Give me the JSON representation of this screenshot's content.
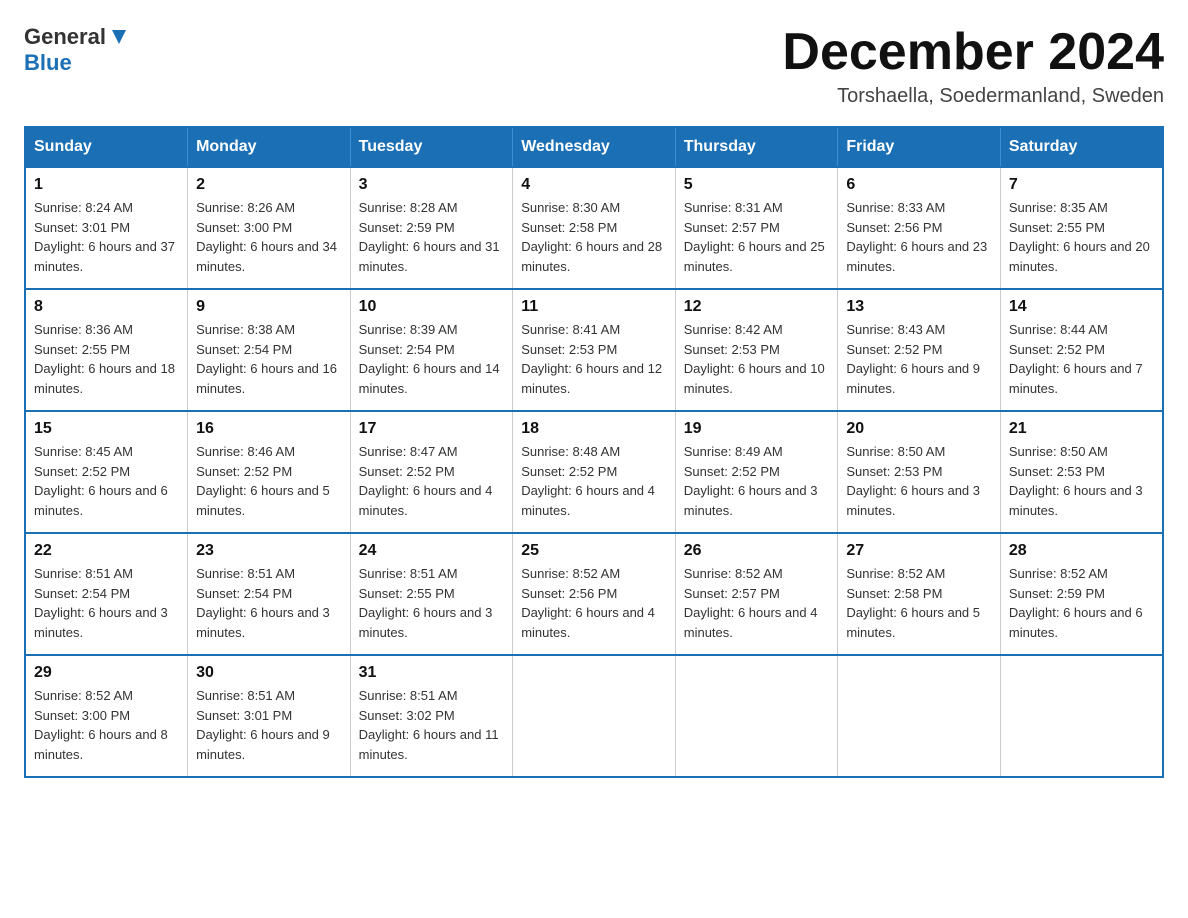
{
  "logo": {
    "general": "General",
    "blue": "Blue"
  },
  "header": {
    "month_year": "December 2024",
    "location": "Torshaella, Soedermanland, Sweden"
  },
  "weekdays": [
    "Sunday",
    "Monday",
    "Tuesday",
    "Wednesday",
    "Thursday",
    "Friday",
    "Saturday"
  ],
  "weeks": [
    [
      {
        "day": "1",
        "sunrise": "8:24 AM",
        "sunset": "3:01 PM",
        "daylight": "6 hours and 37 minutes."
      },
      {
        "day": "2",
        "sunrise": "8:26 AM",
        "sunset": "3:00 PM",
        "daylight": "6 hours and 34 minutes."
      },
      {
        "day": "3",
        "sunrise": "8:28 AM",
        "sunset": "2:59 PM",
        "daylight": "6 hours and 31 minutes."
      },
      {
        "day": "4",
        "sunrise": "8:30 AM",
        "sunset": "2:58 PM",
        "daylight": "6 hours and 28 minutes."
      },
      {
        "day": "5",
        "sunrise": "8:31 AM",
        "sunset": "2:57 PM",
        "daylight": "6 hours and 25 minutes."
      },
      {
        "day": "6",
        "sunrise": "8:33 AM",
        "sunset": "2:56 PM",
        "daylight": "6 hours and 23 minutes."
      },
      {
        "day": "7",
        "sunrise": "8:35 AM",
        "sunset": "2:55 PM",
        "daylight": "6 hours and 20 minutes."
      }
    ],
    [
      {
        "day": "8",
        "sunrise": "8:36 AM",
        "sunset": "2:55 PM",
        "daylight": "6 hours and 18 minutes."
      },
      {
        "day": "9",
        "sunrise": "8:38 AM",
        "sunset": "2:54 PM",
        "daylight": "6 hours and 16 minutes."
      },
      {
        "day": "10",
        "sunrise": "8:39 AM",
        "sunset": "2:54 PM",
        "daylight": "6 hours and 14 minutes."
      },
      {
        "day": "11",
        "sunrise": "8:41 AM",
        "sunset": "2:53 PM",
        "daylight": "6 hours and 12 minutes."
      },
      {
        "day": "12",
        "sunrise": "8:42 AM",
        "sunset": "2:53 PM",
        "daylight": "6 hours and 10 minutes."
      },
      {
        "day": "13",
        "sunrise": "8:43 AM",
        "sunset": "2:52 PM",
        "daylight": "6 hours and 9 minutes."
      },
      {
        "day": "14",
        "sunrise": "8:44 AM",
        "sunset": "2:52 PM",
        "daylight": "6 hours and 7 minutes."
      }
    ],
    [
      {
        "day": "15",
        "sunrise": "8:45 AM",
        "sunset": "2:52 PM",
        "daylight": "6 hours and 6 minutes."
      },
      {
        "day": "16",
        "sunrise": "8:46 AM",
        "sunset": "2:52 PM",
        "daylight": "6 hours and 5 minutes."
      },
      {
        "day": "17",
        "sunrise": "8:47 AM",
        "sunset": "2:52 PM",
        "daylight": "6 hours and 4 minutes."
      },
      {
        "day": "18",
        "sunrise": "8:48 AM",
        "sunset": "2:52 PM",
        "daylight": "6 hours and 4 minutes."
      },
      {
        "day": "19",
        "sunrise": "8:49 AM",
        "sunset": "2:52 PM",
        "daylight": "6 hours and 3 minutes."
      },
      {
        "day": "20",
        "sunrise": "8:50 AM",
        "sunset": "2:53 PM",
        "daylight": "6 hours and 3 minutes."
      },
      {
        "day": "21",
        "sunrise": "8:50 AM",
        "sunset": "2:53 PM",
        "daylight": "6 hours and 3 minutes."
      }
    ],
    [
      {
        "day": "22",
        "sunrise": "8:51 AM",
        "sunset": "2:54 PM",
        "daylight": "6 hours and 3 minutes."
      },
      {
        "day": "23",
        "sunrise": "8:51 AM",
        "sunset": "2:54 PM",
        "daylight": "6 hours and 3 minutes."
      },
      {
        "day": "24",
        "sunrise": "8:51 AM",
        "sunset": "2:55 PM",
        "daylight": "6 hours and 3 minutes."
      },
      {
        "day": "25",
        "sunrise": "8:52 AM",
        "sunset": "2:56 PM",
        "daylight": "6 hours and 4 minutes."
      },
      {
        "day": "26",
        "sunrise": "8:52 AM",
        "sunset": "2:57 PM",
        "daylight": "6 hours and 4 minutes."
      },
      {
        "day": "27",
        "sunrise": "8:52 AM",
        "sunset": "2:58 PM",
        "daylight": "6 hours and 5 minutes."
      },
      {
        "day": "28",
        "sunrise": "8:52 AM",
        "sunset": "2:59 PM",
        "daylight": "6 hours and 6 minutes."
      }
    ],
    [
      {
        "day": "29",
        "sunrise": "8:52 AM",
        "sunset": "3:00 PM",
        "daylight": "6 hours and 8 minutes."
      },
      {
        "day": "30",
        "sunrise": "8:51 AM",
        "sunset": "3:01 PM",
        "daylight": "6 hours and 9 minutes."
      },
      {
        "day": "31",
        "sunrise": "8:51 AM",
        "sunset": "3:02 PM",
        "daylight": "6 hours and 11 minutes."
      },
      null,
      null,
      null,
      null
    ]
  ]
}
